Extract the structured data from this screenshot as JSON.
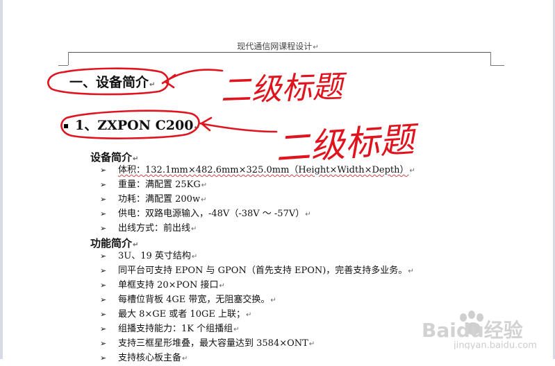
{
  "header": {
    "title": "现代通信网课程设计"
  },
  "heading_1": {
    "text": "一、设备简介"
  },
  "heading_2": {
    "text": "1、ZXPON C200"
  },
  "section_device": {
    "title": "设备简介",
    "items": [
      "体积：132.1mm×482.6mm×325.0mm（Height×Width×Depth）",
      "重量：满配置 25KG",
      "功耗：满配置 200w",
      "供电：双路电源输入，-48V（-38V ～ -57V）",
      "出线方式：前出线"
    ]
  },
  "section_function": {
    "title": "功能简介",
    "items": [
      "3U、19 英寸结构",
      "同平台可支持 EPON 与 GPON（首先支持 EPON)，完善支持多业务。",
      "单框支持 20×PON 接口",
      "每槽位背板 4GE 带宽，无阻塞交换。",
      "最大 8×GE 或者 10GE 上联；",
      "组播支持能力：1K 个组播组",
      "支持三框星形堆叠，最大容量达到 3584×ONT",
      "支持核心板主备"
    ]
  },
  "annotations": {
    "label_1": "二级标题",
    "label_2": "二级标题"
  },
  "watermark": {
    "brand": "Baidu经验",
    "url": "jingyan.baidu.com"
  },
  "colors": {
    "annotation_red": "#e0141e"
  }
}
